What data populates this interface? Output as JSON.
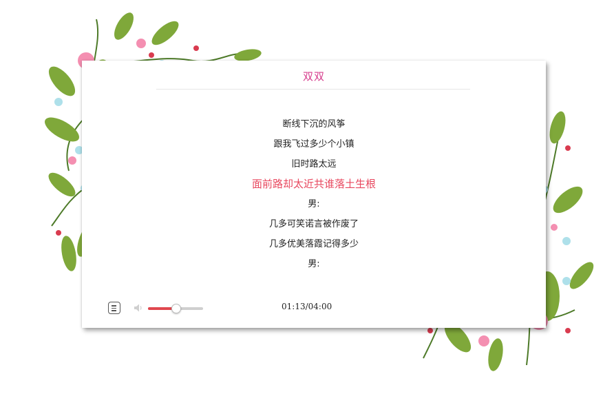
{
  "song": {
    "title": "双双"
  },
  "lyrics": [
    {
      "text": "断线下沉的风筝",
      "current": false
    },
    {
      "text": "跟我飞过多少个小镇",
      "current": false
    },
    {
      "text": "旧时路太远",
      "current": false
    },
    {
      "text": "面前路却太近共谁落土生根",
      "current": true
    },
    {
      "text": "男:",
      "current": false
    },
    {
      "text": "几多可笑诺言被作废了",
      "current": false
    },
    {
      "text": "几多优美落霞记得多少",
      "current": false
    },
    {
      "text": "男:",
      "current": false
    }
  ],
  "player": {
    "elapsed_time": "01:13/04:00",
    "volume": 0.5,
    "lyric_toggle_icon": "lyrics-list-icon",
    "volume_icon": "speaker-icon"
  },
  "colors": {
    "title": "#d63c8c",
    "current_line": "#e8475e",
    "volume_fill": "#e0474f"
  }
}
